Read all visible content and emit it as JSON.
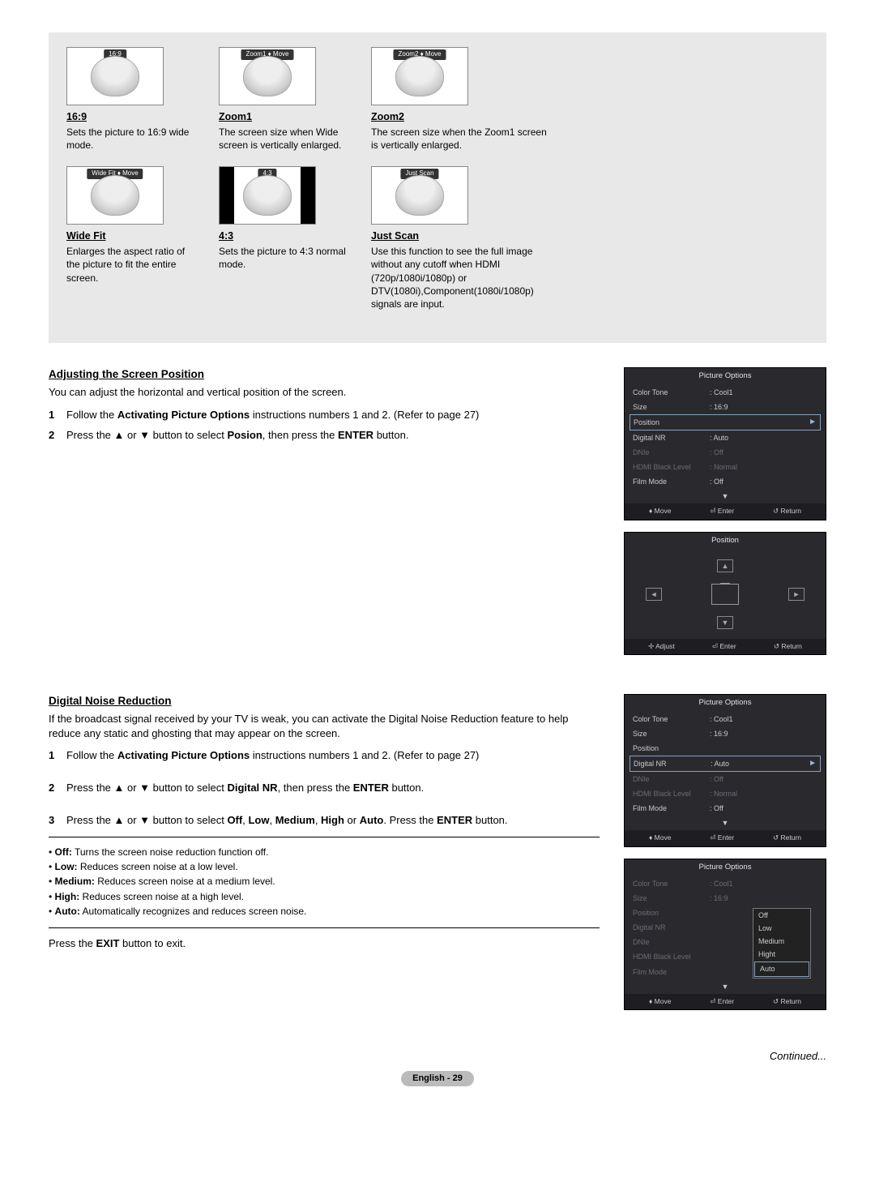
{
  "modes_row1": [
    {
      "tag": "16:9",
      "title": "16:9",
      "desc": "Sets the picture to 16:9 wide mode."
    },
    {
      "tag": "Zoom1 ♦ Move",
      "title": "Zoom1",
      "desc": "The screen size when Wide screen is vertically enlarged."
    },
    {
      "tag": "Zoom2 ♦ Move",
      "title": "Zoom2",
      "desc": "The screen size when the Zoom1 screen is vertically enlarged."
    }
  ],
  "modes_row2": [
    {
      "tag": "Wide Fit ♦ Move",
      "title": "Wide Fit",
      "desc": "Enlarges the aspect ratio of the picture to fit the entire screen."
    },
    {
      "tag": "4:3",
      "title": "4:3",
      "desc": "Sets the picture to 4:3 normal mode.",
      "narrow": true
    },
    {
      "tag": "Just Scan",
      "title": "Just Scan",
      "desc": "Use this function to see the full image without any cutoff when HDMI (720p/1080i/1080p) or DTV(1080i),Component(1080i/1080p) signals are input."
    }
  ],
  "section1": {
    "title": "Adjusting the Screen Position",
    "intro": "You can adjust the horizontal and vertical position of the screen.",
    "step1_a": "Follow the ",
    "step1_b": "Activating Picture Options",
    "step1_c": " instructions numbers 1 and 2. (Refer to page 27)",
    "step2_a": "Press the ▲ or ▼ button to select ",
    "step2_b": "Posion",
    "step2_c": ", then press the ",
    "step2_d": "ENTER",
    "step2_e": " button."
  },
  "osd1": {
    "header": "Picture Options",
    "rows": [
      {
        "label": "Color Tone",
        "val": ": Cool1"
      },
      {
        "label": "Size",
        "val": ": 16:9"
      },
      {
        "label": "Position",
        "val": "",
        "sel": true
      },
      {
        "label": "Digital NR",
        "val": ": Auto"
      },
      {
        "label": "DNIe",
        "val": ": Off",
        "dim": true
      },
      {
        "label": "HDMI Black Level",
        "val": ": Normal",
        "dim": true
      },
      {
        "label": "Film Mode",
        "val": ": Off"
      }
    ],
    "footer": {
      "a": "♦ Move",
      "b": "⏎ Enter",
      "c": "↺ Return"
    }
  },
  "osd_pos": {
    "header": "Position",
    "footer": {
      "a": "✢ Adjust",
      "b": "⏎ Enter",
      "c": "↺ Return"
    }
  },
  "section2": {
    "title": "Digital Noise Reduction",
    "intro": "If the broadcast signal received by your TV is weak, you can activate the Digital Noise Reduction feature to help reduce any static and ghosting that may appear on the screen.",
    "step1_a": "Follow the ",
    "step1_b": "Activating Picture Options",
    "step1_c": " instructions numbers 1 and 2. (Refer to page 27)",
    "step2_a": "Press the ▲ or ▼ button to select ",
    "step2_b": "Digital NR",
    "step2_c": ", then press the ",
    "step2_d": "ENTER",
    "step2_e": " button.",
    "step3_a": "Press the ▲ or ▼ button to select ",
    "step3_b": "Off",
    "step3_c": ", ",
    "step3_d": "Low",
    "step3_e": ", ",
    "step3_f": "Medium",
    "step3_g": ", ",
    "step3_h": "High",
    "step3_i": " or ",
    "step3_j": "Auto",
    "step3_k": ". Press the ",
    "step3_l": "ENTER",
    "step3_m": " button.",
    "bullets": [
      {
        "b": "Off:",
        "t": " Turns the screen noise reduction function off."
      },
      {
        "b": "Low:",
        "t": " Reduces screen noise at a low level."
      },
      {
        "b": "Medium:",
        "t": " Reduces screen noise at a medium level."
      },
      {
        "b": "High:",
        "t": " Reduces screen noise at a high level."
      },
      {
        "b": "Auto:",
        "t": " Automatically recognizes and reduces screen noise."
      }
    ],
    "exit_a": "Press the ",
    "exit_b": "EXIT",
    "exit_c": " button to exit."
  },
  "osd2": {
    "header": "Picture Options",
    "rows": [
      {
        "label": "Color Tone",
        "val": ": Cool1"
      },
      {
        "label": "Size",
        "val": ": 16:9"
      },
      {
        "label": "Position",
        "val": ""
      },
      {
        "label": "Digital NR",
        "val": ": Auto",
        "sel": true
      },
      {
        "label": "DNIe",
        "val": ": Off",
        "dim": true
      },
      {
        "label": "HDMI Black Level",
        "val": ": Normal",
        "dim": true
      },
      {
        "label": "Film Mode",
        "val": ": Off"
      }
    ],
    "footer": {
      "a": "♦ Move",
      "b": "⏎ Enter",
      "c": "↺ Return"
    }
  },
  "osd3": {
    "header": "Picture Options",
    "rows": [
      {
        "label": "Color Tone",
        "val": ": Cool1",
        "dim": true
      },
      {
        "label": "Size",
        "val": ": 16:9",
        "dim": true
      },
      {
        "label": "Position",
        "val": "",
        "dim": true
      },
      {
        "label": "Digital NR",
        "val": "",
        "dim": true
      },
      {
        "label": "DNIe",
        "val": "",
        "dim": true
      },
      {
        "label": "HDMI Black Level",
        "val": "",
        "dim": true
      },
      {
        "label": "Film Mode",
        "val": "",
        "dim": true
      }
    ],
    "dropdown": [
      "Off",
      "Low",
      "Medium",
      "Hight",
      "Auto"
    ],
    "dropdown_sel": 4,
    "footer": {
      "a": "♦ Move",
      "b": "⏎ Enter",
      "c": "↺ Return"
    }
  },
  "continued": "Continued...",
  "page_label": "English - 29"
}
